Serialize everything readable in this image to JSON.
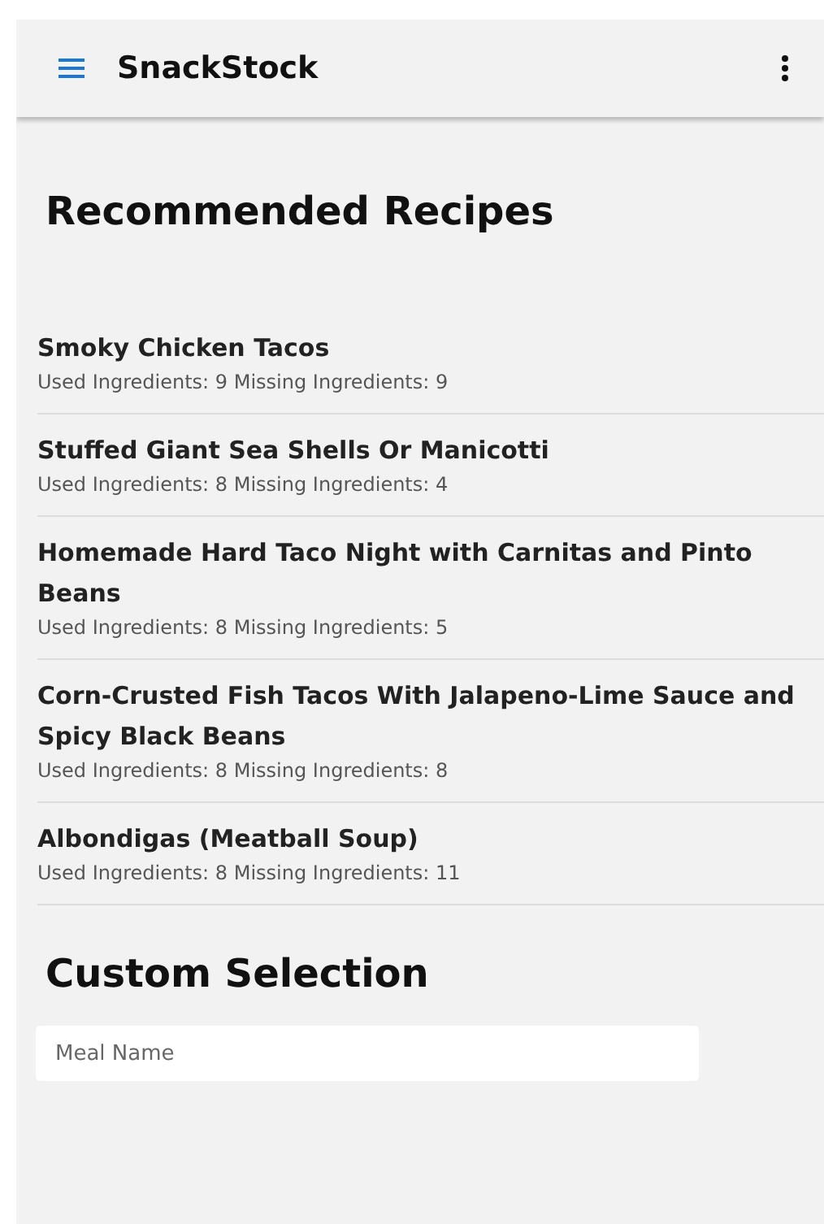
{
  "app_bar": {
    "title": "SnackStock"
  },
  "recommended": {
    "heading": "Recommended Recipes",
    "recipes": [
      {
        "name": "Smoky Chicken Tacos",
        "details": "Used Ingredients: 9 Missing Ingredients: 9"
      },
      {
        "name": "Stuffed Giant Sea Shells Or Manicotti",
        "details": "Used Ingredients: 8 Missing Ingredients: 4"
      },
      {
        "name": "Homemade Hard Taco Night with Carnitas and Pinto Beans",
        "details": "Used Ingredients: 8 Missing Ingredients: 5"
      },
      {
        "name": "Corn-Crusted Fish Tacos With Jalapeno-Lime Sauce and Spicy Black Beans",
        "details": "Used Ingredients: 8 Missing Ingredients: 8"
      },
      {
        "name": "Albondigas (Meatball Soup)",
        "details": "Used Ingredients: 8 Missing Ingredients: 11"
      }
    ]
  },
  "custom": {
    "heading": "Custom Selection",
    "meal_name": {
      "placeholder": "Meal Name"
    }
  }
}
